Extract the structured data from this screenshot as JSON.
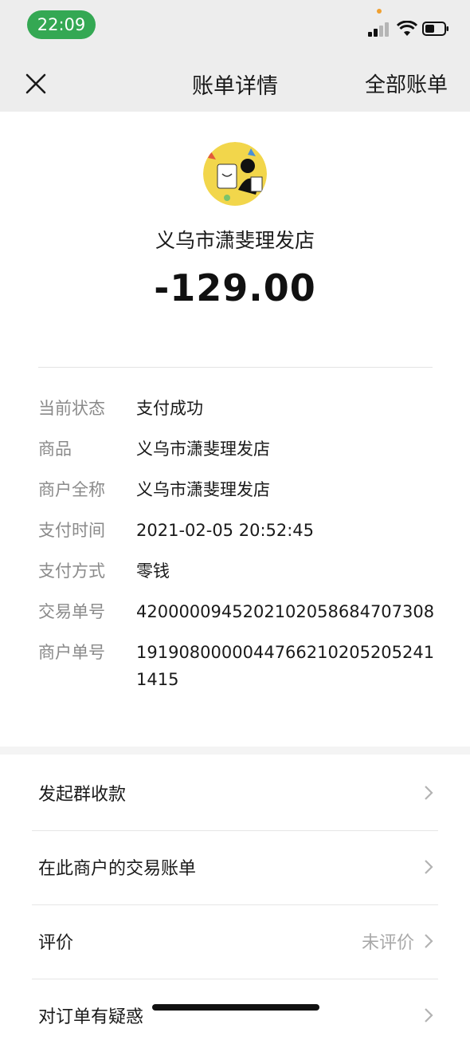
{
  "status_bar": {
    "time": "22:09"
  },
  "nav": {
    "title": "账单详情",
    "right_action": "全部账单",
    "close_icon": "close-icon"
  },
  "header": {
    "merchant_name": "义乌市潇斐理发店",
    "amount": "-129.00"
  },
  "details": [
    {
      "key": "当前状态",
      "value": "支付成功"
    },
    {
      "key": "商品",
      "value": "义乌市潇斐理发店"
    },
    {
      "key": "商户全称",
      "value": "义乌市潇斐理发店"
    },
    {
      "key": "支付时间",
      "value": "2021-02-05 20:52:45"
    },
    {
      "key": "支付方式",
      "value": "零钱"
    },
    {
      "key": "交易单号",
      "value": "4200000945202102058684707308"
    },
    {
      "key": "商户单号",
      "value": "19190800000447662102052052411415"
    }
  ],
  "actions": [
    {
      "label": "发起群收款",
      "extra": ""
    },
    {
      "label": "在此商户的交易账单",
      "extra": ""
    },
    {
      "label": "评价",
      "extra": "未评价"
    },
    {
      "label": "对订单有疑惑",
      "extra": ""
    }
  ],
  "colors": {
    "time_pill": "#34a853",
    "header_bg": "#ededed"
  }
}
